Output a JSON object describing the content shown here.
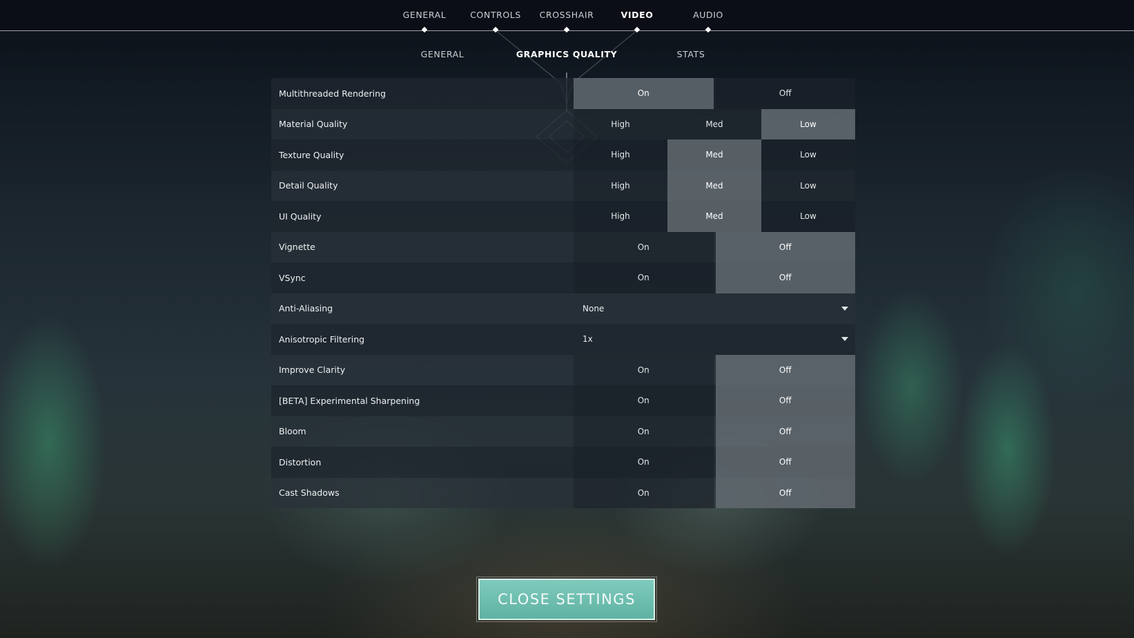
{
  "main_tabs": [
    {
      "label": "GENERAL",
      "active": false
    },
    {
      "label": "CONTROLS",
      "active": false
    },
    {
      "label": "CROSSHAIR",
      "active": false
    },
    {
      "label": "VIDEO",
      "active": true
    },
    {
      "label": "AUDIO",
      "active": false
    }
  ],
  "sub_tabs": [
    {
      "label": "GENERAL",
      "active": false
    },
    {
      "label": "GRAPHICS QUALITY",
      "active": true
    },
    {
      "label": "STATS",
      "active": false
    }
  ],
  "settings": [
    {
      "label": "Multithreaded Rendering",
      "options": [
        "On",
        "Off"
      ],
      "selected": "On"
    },
    {
      "label": "Material Quality",
      "options": [
        "High",
        "Med",
        "Low"
      ],
      "selected": "Low"
    },
    {
      "label": "Texture Quality",
      "options": [
        "High",
        "Med",
        "Low"
      ],
      "selected": "Med"
    },
    {
      "label": "Detail Quality",
      "options": [
        "High",
        "Med",
        "Low"
      ],
      "selected": "Med"
    },
    {
      "label": "UI Quality",
      "options": [
        "High",
        "Med",
        "Low"
      ],
      "selected": "Med"
    },
    {
      "label": "Vignette",
      "options": [
        "On",
        "Off"
      ],
      "selected": "Off"
    },
    {
      "label": "VSync",
      "options": [
        "On",
        "Off"
      ],
      "selected": "Off"
    },
    {
      "label": "Anti-Aliasing",
      "dropdown": true,
      "value": "None"
    },
    {
      "label": "Anisotropic Filtering",
      "dropdown": true,
      "value": "1x"
    },
    {
      "label": "Improve Clarity",
      "options": [
        "On",
        "Off"
      ],
      "selected": "Off"
    },
    {
      "label": "[BETA] Experimental Sharpening",
      "options": [
        "On",
        "Off"
      ],
      "selected": "Off"
    },
    {
      "label": "Bloom",
      "options": [
        "On",
        "Off"
      ],
      "selected": "Off"
    },
    {
      "label": "Distortion",
      "options": [
        "On",
        "Off"
      ],
      "selected": "Off"
    },
    {
      "label": "Cast Shadows",
      "options": [
        "On",
        "Off"
      ],
      "selected": "Off"
    }
  ],
  "close_button": {
    "label": "CLOSE SETTINGS"
  },
  "colors": {
    "accent": "#6fbfb1",
    "selected_option": "#6e767c",
    "topbar": "#0b0e16"
  },
  "icons": {
    "dropdown": "chevron-down-icon",
    "tab_marker": "diamond-icon"
  }
}
